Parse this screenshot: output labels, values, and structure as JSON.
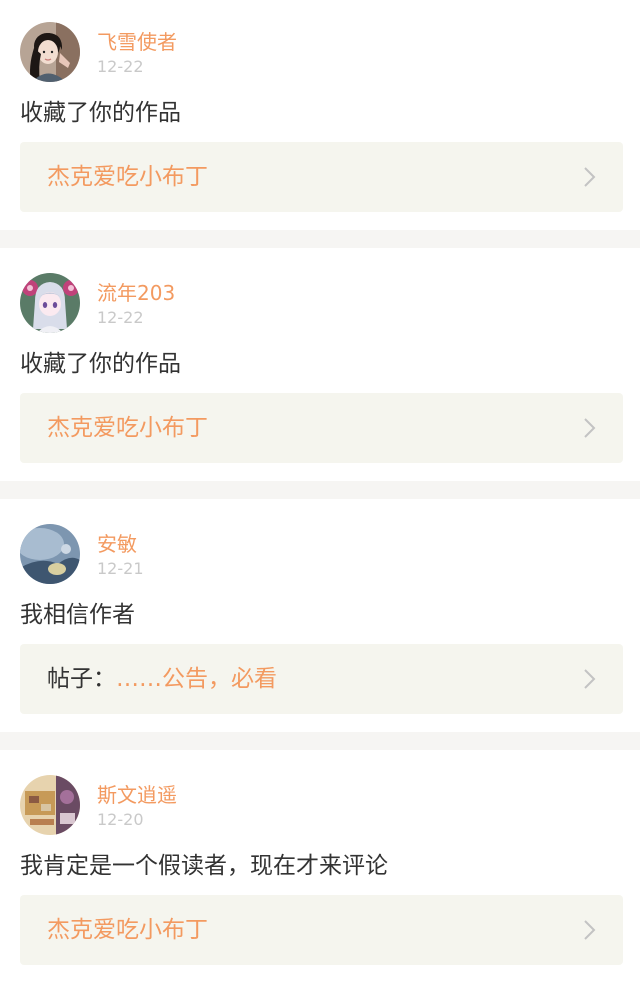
{
  "notifications": [
    {
      "username": "飞雪使者",
      "time": "12-22",
      "message": "收藏了你的作品",
      "link_prefix": "",
      "link_title": "杰克爱吃小布丁"
    },
    {
      "username": "流年203",
      "time": "12-22",
      "message": "收藏了你的作品",
      "link_prefix": "",
      "link_title": "杰克爱吃小布丁"
    },
    {
      "username": "安敏",
      "time": "12-21",
      "message": "我相信作者",
      "link_prefix": "帖子：",
      "link_title": "……公告，必看"
    },
    {
      "username": "斯文逍遥",
      "time": "12-20",
      "message": "我肯定是一个假读者，现在才来评论",
      "link_prefix": "",
      "link_title": "杰克爱吃小布丁"
    }
  ],
  "colors": {
    "accent": "#f39a60",
    "text": "#333333",
    "muted": "#c9c9c9",
    "link_box": "#f5f5ee",
    "separator": "#f6f5f3"
  },
  "icons": {
    "chevron": "chevron-right-icon"
  }
}
